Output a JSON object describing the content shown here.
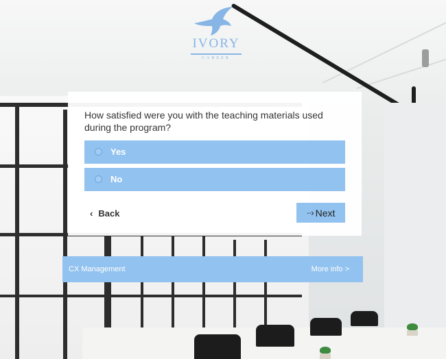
{
  "brand": {
    "logo_icon": "eagle-icon",
    "name": "IVORY",
    "tagline": "CAREER",
    "accent_color": "#92c2ef",
    "logo_color": "#86b5e6"
  },
  "survey": {
    "question": "How satisfied were you with the teaching materials used during the program?",
    "options": [
      {
        "label": "Yes",
        "selected": false
      },
      {
        "label": "No",
        "selected": false
      }
    ],
    "back_label": "Back",
    "next_label": "Next"
  },
  "footer": {
    "left_text": "CX Management",
    "right_link": "More info >"
  }
}
